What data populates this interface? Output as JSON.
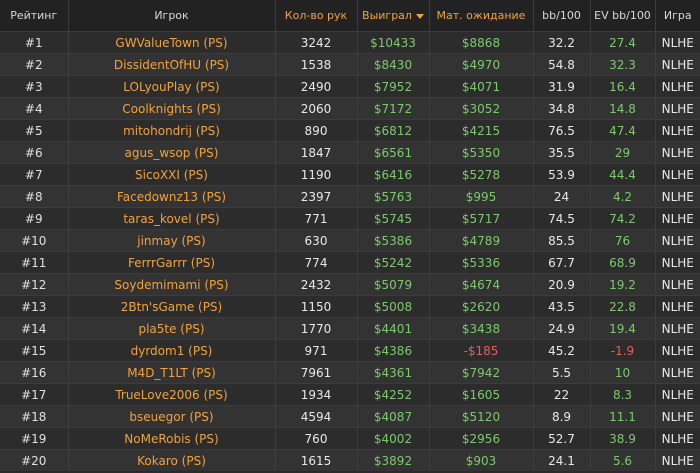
{
  "columns": [
    {
      "key": "rank",
      "label": "Рейтинг"
    },
    {
      "key": "player",
      "label": "Игрок"
    },
    {
      "key": "hands",
      "label": "Кол-во рук"
    },
    {
      "key": "won",
      "label": "Выиграл"
    },
    {
      "key": "ev",
      "label": "Мат. ожидание"
    },
    {
      "key": "bb100",
      "label": "bb/100"
    },
    {
      "key": "evbb100",
      "label": "EV bb/100"
    },
    {
      "key": "game",
      "label": "Игра"
    }
  ],
  "sorted_column": "won",
  "colors": {
    "accent_orange": "#f0a33b",
    "positive_green": "#7ec96e",
    "negative_red": "#e85c5c"
  },
  "rows": [
    {
      "rank": "#1",
      "player": "GWValueTown (PS)",
      "hands": "3242",
      "won": "$10433",
      "ev": "$8868",
      "bb100": "32.2",
      "evbb100": "27.4",
      "game": "NLHE"
    },
    {
      "rank": "#2",
      "player": "DissidentOfHU (PS)",
      "hands": "1538",
      "won": "$8430",
      "ev": "$4970",
      "bb100": "54.8",
      "evbb100": "32.3",
      "game": "NLHE"
    },
    {
      "rank": "#3",
      "player": "LOLyouPlay (PS)",
      "hands": "2490",
      "won": "$7952",
      "ev": "$4071",
      "bb100": "31.9",
      "evbb100": "16.4",
      "game": "NLHE"
    },
    {
      "rank": "#4",
      "player": "Coolknights (PS)",
      "hands": "2060",
      "won": "$7172",
      "ev": "$3052",
      "bb100": "34.8",
      "evbb100": "14.8",
      "game": "NLHE"
    },
    {
      "rank": "#5",
      "player": "mitohondrij (PS)",
      "hands": "890",
      "won": "$6812",
      "ev": "$4215",
      "bb100": "76.5",
      "evbb100": "47.4",
      "game": "NLHE"
    },
    {
      "rank": "#6",
      "player": "agus_wsop (PS)",
      "hands": "1847",
      "won": "$6561",
      "ev": "$5350",
      "bb100": "35.5",
      "evbb100": "29",
      "game": "NLHE"
    },
    {
      "rank": "#7",
      "player": "SicoXXI (PS)",
      "hands": "1190",
      "won": "$6416",
      "ev": "$5278",
      "bb100": "53.9",
      "evbb100": "44.4",
      "game": "NLHE"
    },
    {
      "rank": "#8",
      "player": "Facedownz13 (PS)",
      "hands": "2397",
      "won": "$5763",
      "ev": "$995",
      "bb100": "24",
      "evbb100": "4.2",
      "game": "NLHE"
    },
    {
      "rank": "#9",
      "player": "taras_kovel (PS)",
      "hands": "771",
      "won": "$5745",
      "ev": "$5717",
      "bb100": "74.5",
      "evbb100": "74.2",
      "game": "NLHE"
    },
    {
      "rank": "#10",
      "player": "jinmay (PS)",
      "hands": "630",
      "won": "$5386",
      "ev": "$4789",
      "bb100": "85.5",
      "evbb100": "76",
      "game": "NLHE"
    },
    {
      "rank": "#11",
      "player": "FerrrGarrr (PS)",
      "hands": "774",
      "won": "$5242",
      "ev": "$5336",
      "bb100": "67.7",
      "evbb100": "68.9",
      "game": "NLHE"
    },
    {
      "rank": "#12",
      "player": "Soydemimami (PS)",
      "hands": "2432",
      "won": "$5079",
      "ev": "$4674",
      "bb100": "20.9",
      "evbb100": "19.2",
      "game": "NLHE"
    },
    {
      "rank": "#13",
      "player": "2Btn'sGame (PS)",
      "hands": "1150",
      "won": "$5008",
      "ev": "$2620",
      "bb100": "43.5",
      "evbb100": "22.8",
      "game": "NLHE"
    },
    {
      "rank": "#14",
      "player": "pla5te (PS)",
      "hands": "1770",
      "won": "$4401",
      "ev": "$3438",
      "bb100": "24.9",
      "evbb100": "19.4",
      "game": "NLHE"
    },
    {
      "rank": "#15",
      "player": "dyrdom1 (PS)",
      "hands": "971",
      "won": "$4386",
      "ev": "-$185",
      "bb100": "45.2",
      "evbb100": "-1.9",
      "game": "NLHE"
    },
    {
      "rank": "#16",
      "player": "M4D_T1LT (PS)",
      "hands": "7961",
      "won": "$4361",
      "ev": "$7942",
      "bb100": "5.5",
      "evbb100": "10",
      "game": "NLHE"
    },
    {
      "rank": "#17",
      "player": "TrueLove2006 (PS)",
      "hands": "1934",
      "won": "$4252",
      "ev": "$1605",
      "bb100": "22",
      "evbb100": "8.3",
      "game": "NLHE"
    },
    {
      "rank": "#18",
      "player": "bseuegor (PS)",
      "hands": "4594",
      "won": "$4087",
      "ev": "$5120",
      "bb100": "8.9",
      "evbb100": "11.1",
      "game": "NLHE"
    },
    {
      "rank": "#19",
      "player": "NoMeRobis (PS)",
      "hands": "760",
      "won": "$4002",
      "ev": "$2956",
      "bb100": "52.7",
      "evbb100": "38.9",
      "game": "NLHE"
    },
    {
      "rank": "#20",
      "player": "Kokaro (PS)",
      "hands": "1615",
      "won": "$3892",
      "ev": "$903",
      "bb100": "24.1",
      "evbb100": "5.6",
      "game": "NLHE"
    }
  ]
}
